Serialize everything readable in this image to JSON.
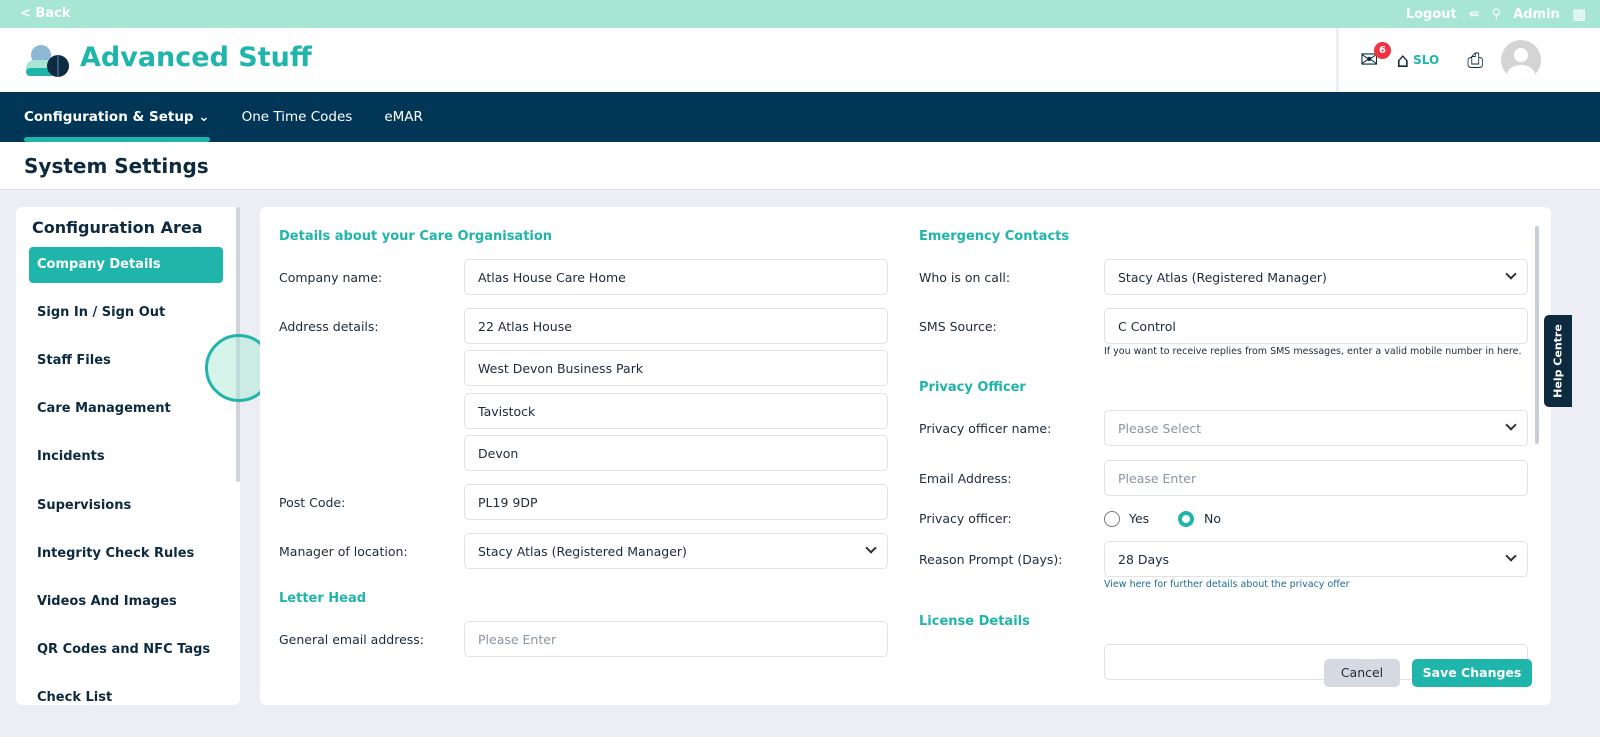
{
  "topbar": {
    "back": "< Back",
    "logout": "Logout",
    "admin": "Admin"
  },
  "header": {
    "brand": "Advanced Stuff",
    "mail_count": "6",
    "home_label": "SLO"
  },
  "nav": {
    "items": [
      "Configuration & Setup",
      "One Time Codes",
      "eMAR"
    ]
  },
  "page_title": "System Settings",
  "sidebar": {
    "title": "Configuration Area",
    "items": [
      "Company Details",
      "Sign In / Sign Out",
      "Staff Files",
      "Care Management",
      "Incidents",
      "Supervisions",
      "Integrity Check Rules",
      "Videos And Images",
      "QR Codes and NFC Tags",
      "Check List"
    ]
  },
  "left": {
    "section1": "Details about your Care Organisation",
    "company_label": "Company name:",
    "company": "Atlas House Care Home",
    "address_label": "Address details:",
    "address": [
      "22 Atlas House",
      "West Devon Business Park",
      "Tavistock",
      "Devon"
    ],
    "postcode_label": "Post Code:",
    "postcode": "PL19 9DP",
    "manager_label": "Manager of location:",
    "manager": "Stacy Atlas (Registered Manager)",
    "section2": "Letter Head",
    "email_label": "General email address:",
    "email_placeholder": "Please Enter"
  },
  "right": {
    "section1": "Emergency Contacts",
    "oncall_label": "Who is on call:",
    "oncall": "Stacy Atlas (Registered Manager)",
    "sms_label": "SMS Source:",
    "sms": "C Control",
    "sms_note": "If you want to receive replies from SMS messages, enter a valid mobile number in here.",
    "section2": "Privacy Officer",
    "po_name_label": "Privacy officer name:",
    "po_name_placeholder": "Please Select",
    "po_email_label": "Email Address:",
    "po_email_placeholder": "Please Enter",
    "po_label": "Privacy officer:",
    "yes": "Yes",
    "no": "No",
    "reason_label": "Reason Prompt (Days):",
    "reason": "28 Days",
    "privacy_link": "View here for further details about the privacy offer",
    "section3": "License Details"
  },
  "actions": {
    "cancel": "Cancel",
    "save": "Save Changes"
  },
  "help": "Help Centre",
  "colors": {
    "accent": "#1fb5aa",
    "navy": "#023657",
    "mint": "#a6e6d2"
  }
}
